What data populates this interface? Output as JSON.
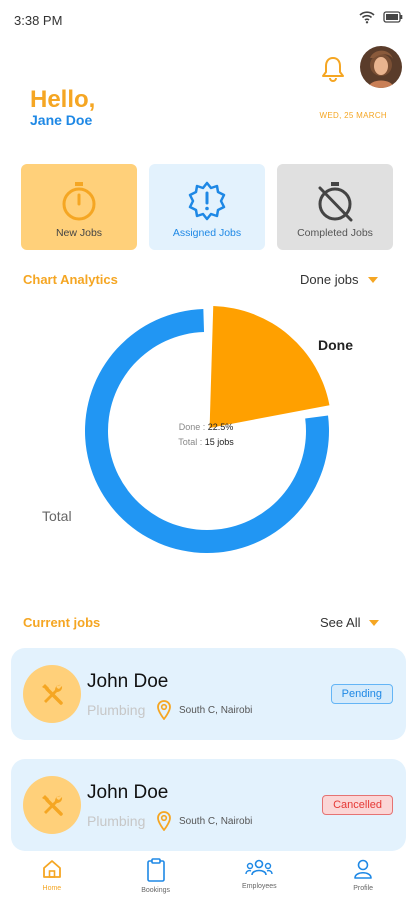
{
  "status_bar": {
    "time": "3:38 PM"
  },
  "header": {
    "greeting": "Hello,",
    "user_name": "Jane Doe",
    "date": "WED, 25 MARCH"
  },
  "categories": [
    {
      "label": "New Jobs"
    },
    {
      "label": "Assigned Jobs"
    },
    {
      "label": "Completed Jobs"
    }
  ],
  "analytics": {
    "title": "Chart Analytics",
    "filter": "Done jobs"
  },
  "chart_data": {
    "type": "pie",
    "style": "donut",
    "slices": [
      {
        "label": "Done",
        "value": 22.5,
        "color": "#ffa000"
      },
      {
        "label": "Total",
        "value": 77.5,
        "color": "#2196f3"
      }
    ],
    "center_lines": [
      {
        "key": "Done :",
        "value": "22.5%"
      },
      {
        "key": "Total :",
        "value": "15 jobs"
      }
    ]
  },
  "current_jobs": {
    "title": "Current jobs",
    "see_all": "See All",
    "jobs": [
      {
        "name": "John Doe",
        "category": "Plumbing",
        "location": "South C, Nairobi",
        "status": "Pending"
      },
      {
        "name": "John Doe",
        "category": "Plumbing",
        "location": "South C, Nairobi",
        "status": "Cancelled"
      }
    ]
  },
  "nav": {
    "items": [
      {
        "label": "Home",
        "icon": "home-icon"
      },
      {
        "label": "Bookings",
        "icon": "clipboard-icon"
      },
      {
        "label": "Employees",
        "icon": "people-icon"
      },
      {
        "label": "Profile",
        "icon": "person-icon"
      }
    ]
  },
  "colors": {
    "accent": "#f5a623",
    "primary": "#1e88e5",
    "done_slice": "#ffa000",
    "total_slice": "#2196f3"
  }
}
